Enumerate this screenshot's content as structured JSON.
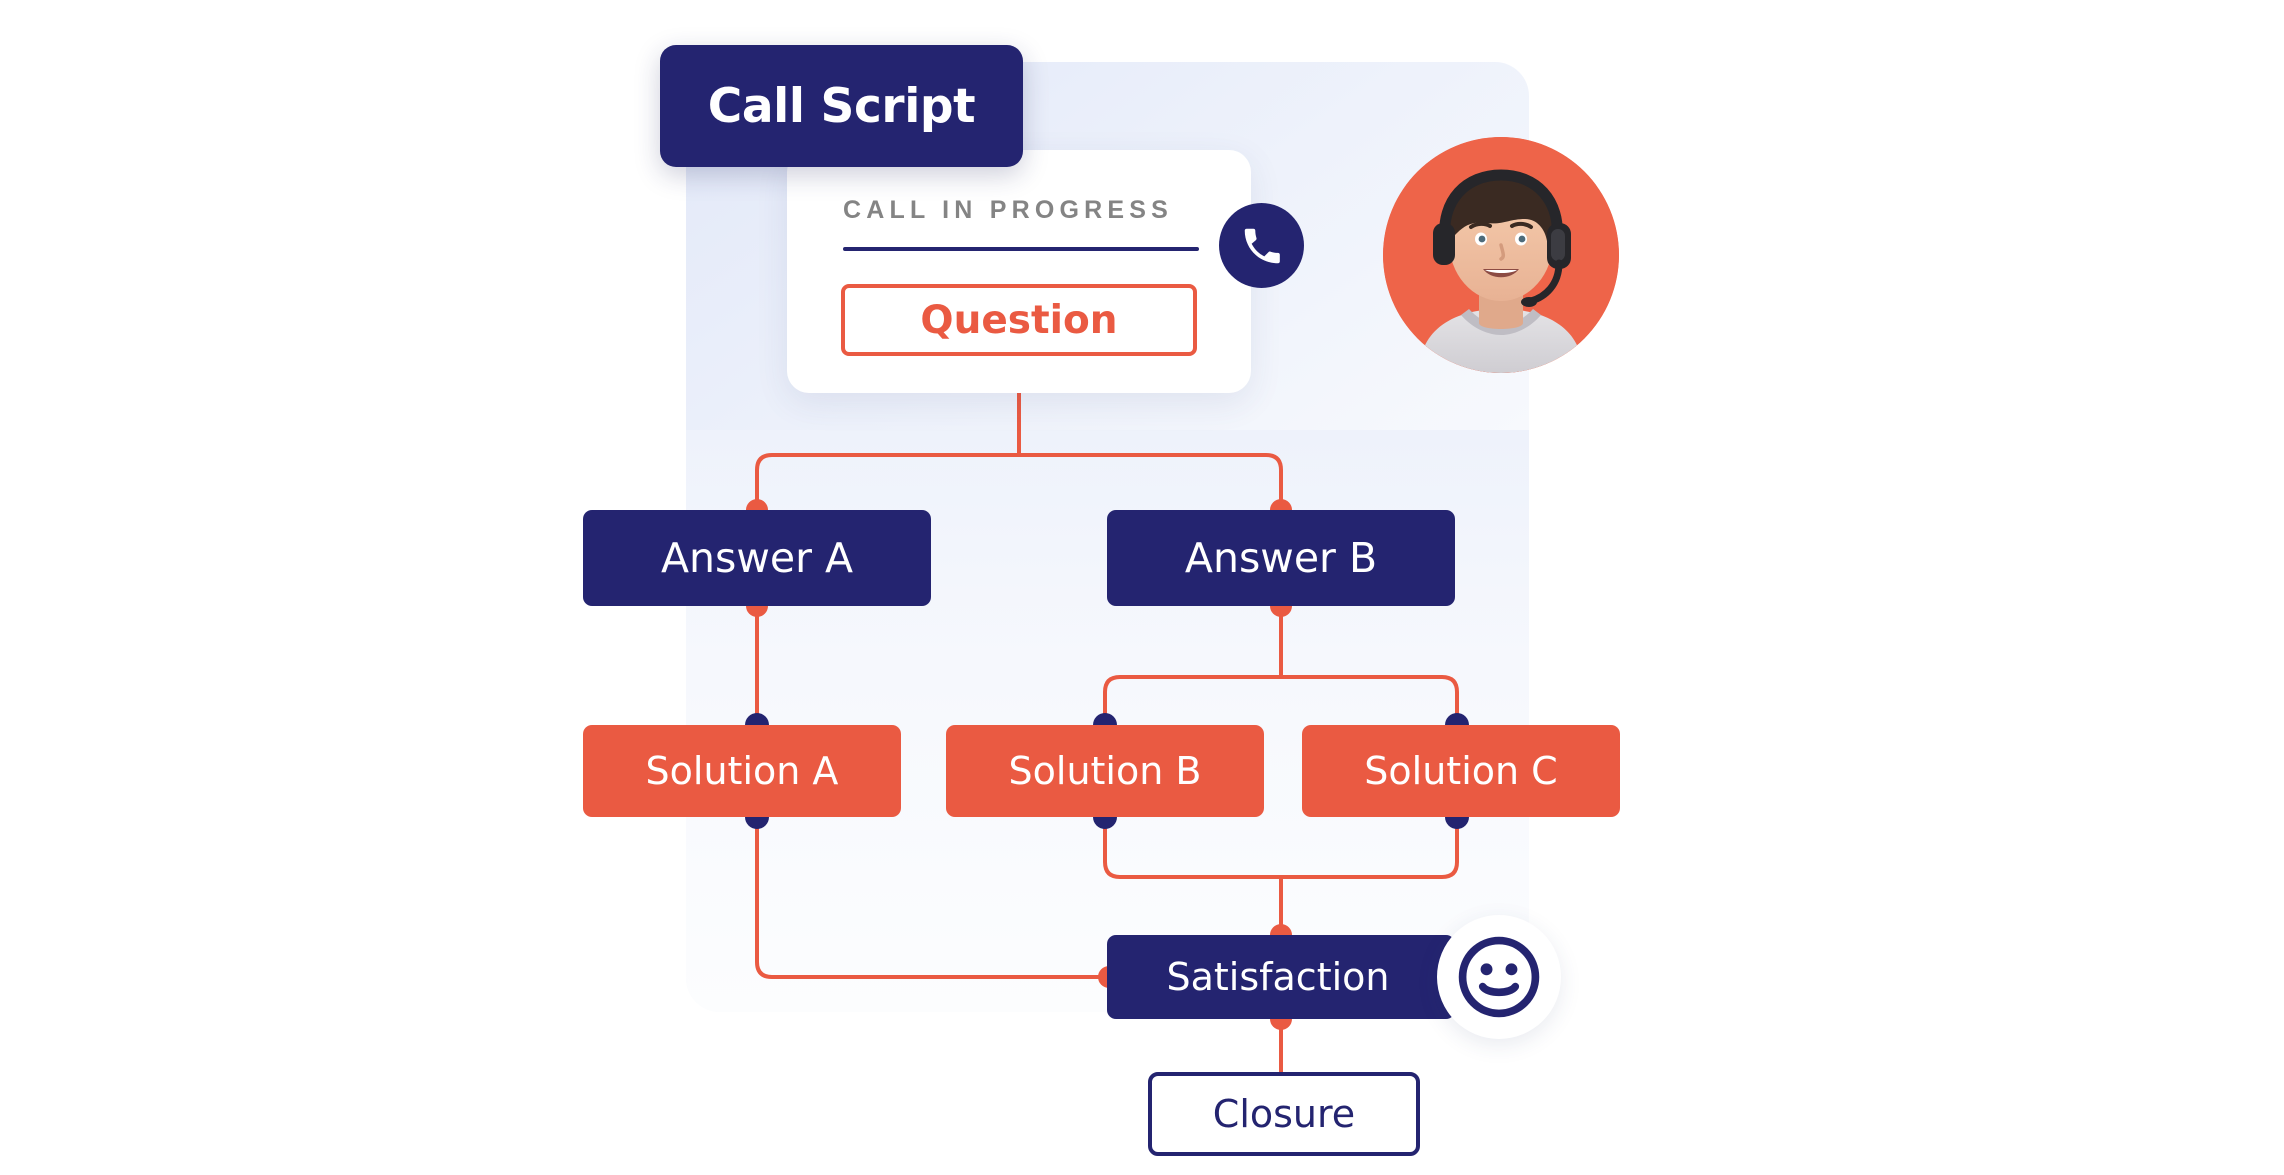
{
  "title_chip": {
    "label": "Call Script"
  },
  "call_card": {
    "status_label": "CALL IN PROGRESS",
    "phone_icon": "phone-handset-icon",
    "question_label": "Question"
  },
  "agent": {
    "avatar_icon": "agent-headset-avatar"
  },
  "flow": {
    "nodes": [
      {
        "id": "question",
        "label": "Question",
        "style": "outline-orange"
      },
      {
        "id": "answer-a",
        "label": "Answer A",
        "style": "filled-navy"
      },
      {
        "id": "answer-b",
        "label": "Answer B",
        "style": "filled-navy"
      },
      {
        "id": "solution-a",
        "label": "Solution A",
        "style": "filled-orange"
      },
      {
        "id": "solution-b",
        "label": "Solution B",
        "style": "filled-orange"
      },
      {
        "id": "solution-c",
        "label": "Solution C",
        "style": "filled-orange"
      },
      {
        "id": "satisfaction",
        "label": "Satisfaction",
        "style": "filled-navy"
      },
      {
        "id": "closure",
        "label": "Closure",
        "style": "outline-navy"
      }
    ],
    "edges": [
      {
        "from": "question",
        "to": "answer-a"
      },
      {
        "from": "question",
        "to": "answer-b"
      },
      {
        "from": "answer-a",
        "to": "solution-a"
      },
      {
        "from": "answer-b",
        "to": "solution-b"
      },
      {
        "from": "answer-b",
        "to": "solution-c"
      },
      {
        "from": "solution-a",
        "to": "satisfaction"
      },
      {
        "from": "solution-b",
        "to": "satisfaction"
      },
      {
        "from": "solution-c",
        "to": "satisfaction"
      },
      {
        "from": "satisfaction",
        "to": "closure"
      }
    ]
  },
  "badges": {
    "smiley_icon": "smiley-face-icon"
  },
  "colors": {
    "navy": "#242470",
    "orange": "#ea5a42",
    "orange_fill": "#ea5a42",
    "status_gray": "#848484",
    "panel_bg": "#eef2fb",
    "page_bg": "#ffffff"
  }
}
